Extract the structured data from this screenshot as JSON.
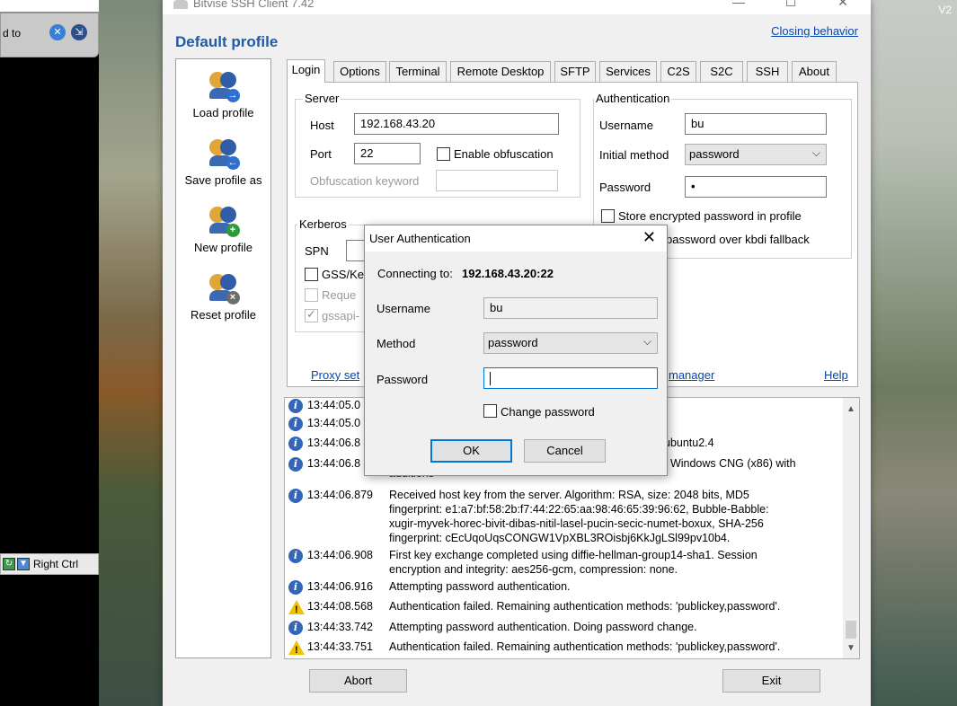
{
  "background": {
    "corner_text": "V2",
    "vm_status_text": "d to",
    "vm_host_key": "Right Ctrl"
  },
  "window": {
    "title": "Bitvise SSH Client 7.42",
    "profile_title": "Default profile",
    "closing_behavior_link": "Closing behavior"
  },
  "sidebar": {
    "items": [
      {
        "label": "Load profile",
        "icon": "load-profile-icon",
        "badge": "→",
        "badge_color": "#2f6fd0"
      },
      {
        "label": "Save profile as",
        "icon": "save-profile-icon",
        "badge": "←",
        "badge_color": "#2f6fd0"
      },
      {
        "label": "New profile",
        "icon": "new-profile-icon",
        "badge": "+",
        "badge_color": "#2e9b3a"
      },
      {
        "label": "Reset profile",
        "icon": "reset-profile-icon",
        "badge": "×",
        "badge_color": "#6d6d6d"
      }
    ]
  },
  "tabs": [
    "Login",
    "Options",
    "Terminal",
    "Remote Desktop",
    "SFTP",
    "Services",
    "C2S",
    "S2C",
    "SSH",
    "About"
  ],
  "login": {
    "server": {
      "title": "Server",
      "host_label": "Host",
      "host_value": "192.168.43.20",
      "port_label": "Port",
      "port_value": "22",
      "obfuscation_label": "Enable obfuscation",
      "obfuscation_keyword_label": "Obfuscation keyword"
    },
    "authentication": {
      "title": "Authentication",
      "username_label": "Username",
      "username_value": "bu",
      "method_label": "Initial method",
      "method_value": "password",
      "password_label": "Password",
      "password_value": "•",
      "store_password_label": "Store encrypted password in profile",
      "kbdi_fallback_label": "password over kbdi fallback"
    },
    "kerberos": {
      "title": "Kerberos",
      "spn_label": "SPN",
      "gss_label": "GSS/Ke",
      "request_label": "Reque",
      "gssapi_label": "gssapi-"
    },
    "proxy_link": "Proxy set",
    "manager_link": "manager",
    "help_link": "Help"
  },
  "log": {
    "entries": [
      {
        "type": "info",
        "time": "13:44:05.0",
        "msg": ""
      },
      {
        "type": "info",
        "time": "13:44:05.0",
        "msg": ""
      },
      {
        "type": "info",
        "time": "13:44:06.8",
        "msg": "ubuntu2.4"
      },
      {
        "type": "info",
        "time": "13:44:06.8",
        "msg": ": Windows CNG (x86) with"
      },
      {
        "type": "info",
        "time": "13:44:06.879",
        "msg": "Received host key from the server. Algorithm: RSA, size: 2048 bits, MD5\nfingerprint: e1:a7:bf:58:2b:f7:44:22:65:aa:98:46:65:39:96:62, Bubble-Babble:\nxugir-myvek-horec-bivit-dibas-nitil-lasel-pucin-secic-numet-boxux, SHA-256\nfingerprint: cEcUqoUqsCONGW1VpXBL3ROisbj6KkJgLSl99pv10b4."
      },
      {
        "type": "info",
        "time": "13:44:06.908",
        "msg": "First key exchange completed using diffie-hellman-group14-sha1. Session\nencryption and integrity: aes256-gcm, compression: none."
      },
      {
        "type": "info",
        "time": "13:44:06.916",
        "msg": "Attempting password authentication."
      },
      {
        "type": "warn",
        "time": "13:44:08.568",
        "msg": "Authentication failed. Remaining authentication methods: 'publickey,password'."
      },
      {
        "type": "info",
        "time": "13:44:33.742",
        "msg": "Attempting password authentication. Doing password change."
      },
      {
        "type": "warn",
        "time": "13:44:33.751",
        "msg": "Authentication failed. Remaining authentication methods: 'publickey,password'."
      }
    ],
    "partial_text": "additions"
  },
  "buttons": {
    "abort": "Abort",
    "exit": "Exit"
  },
  "dialog": {
    "title": "User Authentication",
    "connecting_label": "Connecting to:",
    "connecting_value": "192.168.43.20:22",
    "username_label": "Username",
    "username_value": "bu",
    "method_label": "Method",
    "method_value": "password",
    "password_label": "Password",
    "change_password_label": "Change password",
    "ok": "OK",
    "cancel": "Cancel"
  }
}
